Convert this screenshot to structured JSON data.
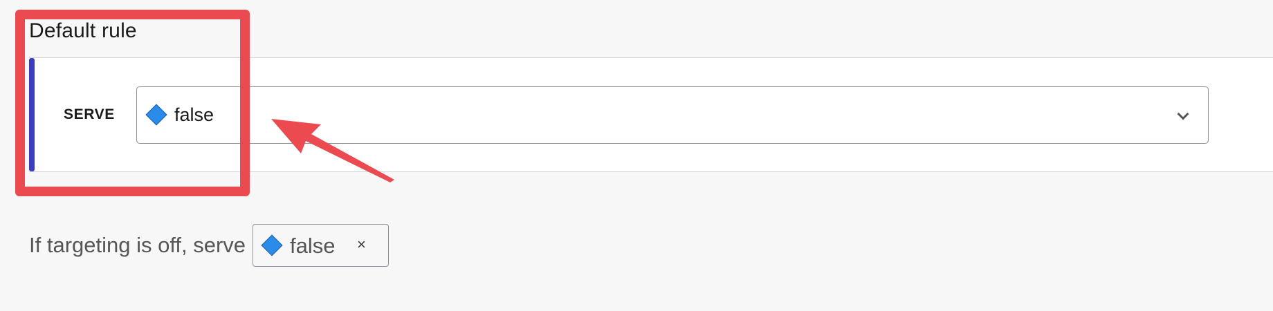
{
  "section": {
    "title": "Default rule"
  },
  "rule": {
    "serve_label": "SERVE",
    "variation": {
      "value": "false",
      "icon": "diamond-icon"
    },
    "dropdown_icon": "chevron-down-icon"
  },
  "fallback": {
    "text": "If targeting is off, serve",
    "variation": {
      "value": "false",
      "icon": "diamond-icon"
    },
    "remove_label": "×"
  },
  "colors": {
    "accent_bar": "#3b3dbf",
    "variation_diamond": "#2b8be8",
    "annotation_red": "#ea4a50"
  }
}
